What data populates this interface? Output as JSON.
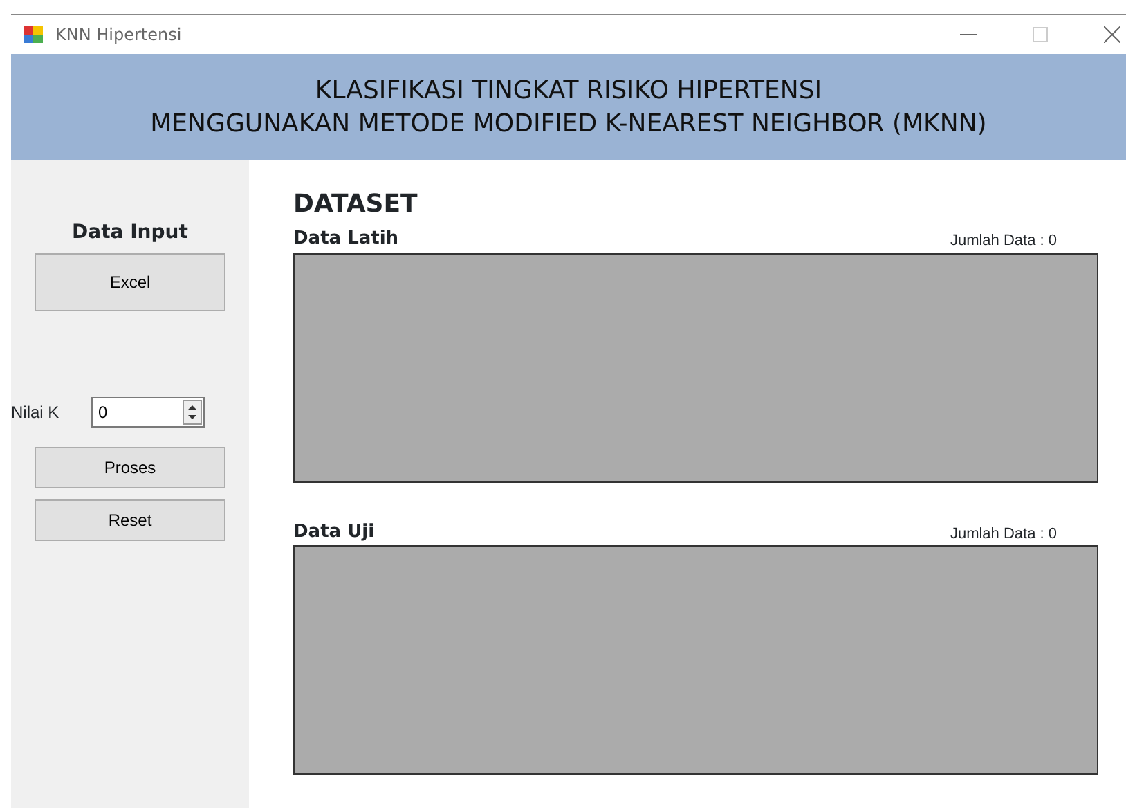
{
  "window": {
    "title": "KNN Hipertensi"
  },
  "header": {
    "lines": [
      "KLASIFIKASI TINGKAT RISIKO HIPERTENSI",
      "MENGGUNAKAN METODE MODIFIED K-NEAREST NEIGHBOR (MKNN)"
    ]
  },
  "sidebar": {
    "section_title": "Data Input",
    "import_button": "Excel",
    "k_label": "Nilai K",
    "k_value": "0",
    "buttons": [
      "Proses",
      "Reset"
    ]
  },
  "main": {
    "title": "DATASET",
    "grids": [
      {
        "title": "Data Latih",
        "count": "Jumlah Data : 0"
      },
      {
        "title": "Data Uji",
        "count": "Jumlah Data : 0"
      }
    ]
  }
}
